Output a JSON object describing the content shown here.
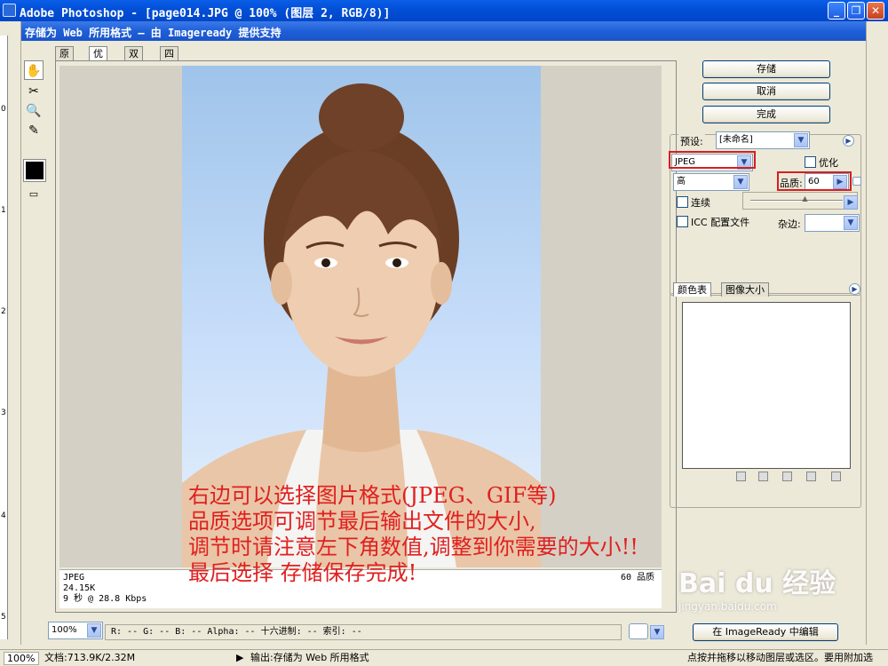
{
  "window": {
    "title": "Adobe Photoshop - [page014.JPG @ 100% (图层 2, RGB/8)]",
    "minimize": "_",
    "restore": "❐",
    "close": "✕"
  },
  "ruler": [
    "0",
    "1",
    "2",
    "3",
    "4",
    "5"
  ],
  "dialog": {
    "title": "存储为 Web 所用格式 — 由 Imageready 提供支持"
  },
  "view_tabs": [
    "原稿",
    "优化",
    "双联",
    "四联"
  ],
  "preview": {
    "format": "JPEG",
    "size": "24.15K",
    "time": "9 秒 @ 28.8 Kbps",
    "quality_note": "60 品质"
  },
  "annotation": [
    "右边可以选择图片格式(JPEG、GIF等)",
    "品质选项可调节最后输出文件的大小,",
    "   调节时请注意左下角数值,调整到你需要的大小!!",
    "最后选择   存储保存完成!"
  ],
  "bottom": {
    "zoom": "100%",
    "readout": "R:  --  G:  --  B:  --  Alpha:  --  十六进制:        --  索引:  --",
    "imageready_button": "在 ImageReady 中编辑"
  },
  "buttons": {
    "save": "存储",
    "cancel": "取消",
    "done": "完成"
  },
  "settings": {
    "preset_label": "预设:",
    "preset_value": "[未命名]",
    "format_value": "JPEG",
    "optimize_label": "优化",
    "quality_level": "高",
    "quality_label": "品质:",
    "quality_value": "60",
    "quality_fraction": 0.6,
    "progressive_label": "连续",
    "icc_label": "ICC 配置文件",
    "matte_label": "杂边:"
  },
  "panel_tabs": [
    "颜色表",
    "图像大小"
  ],
  "statusbar": {
    "zoom": "100%",
    "doc": "文档:713.9K/2.32M",
    "output": "输出:存储为 Web 所用格式",
    "hint": "点按并拖移以移动图层或选区。要用附加选"
  },
  "watermark": {
    "brand": "Bai du 经验",
    "url": "jingyan.baidu.com"
  }
}
